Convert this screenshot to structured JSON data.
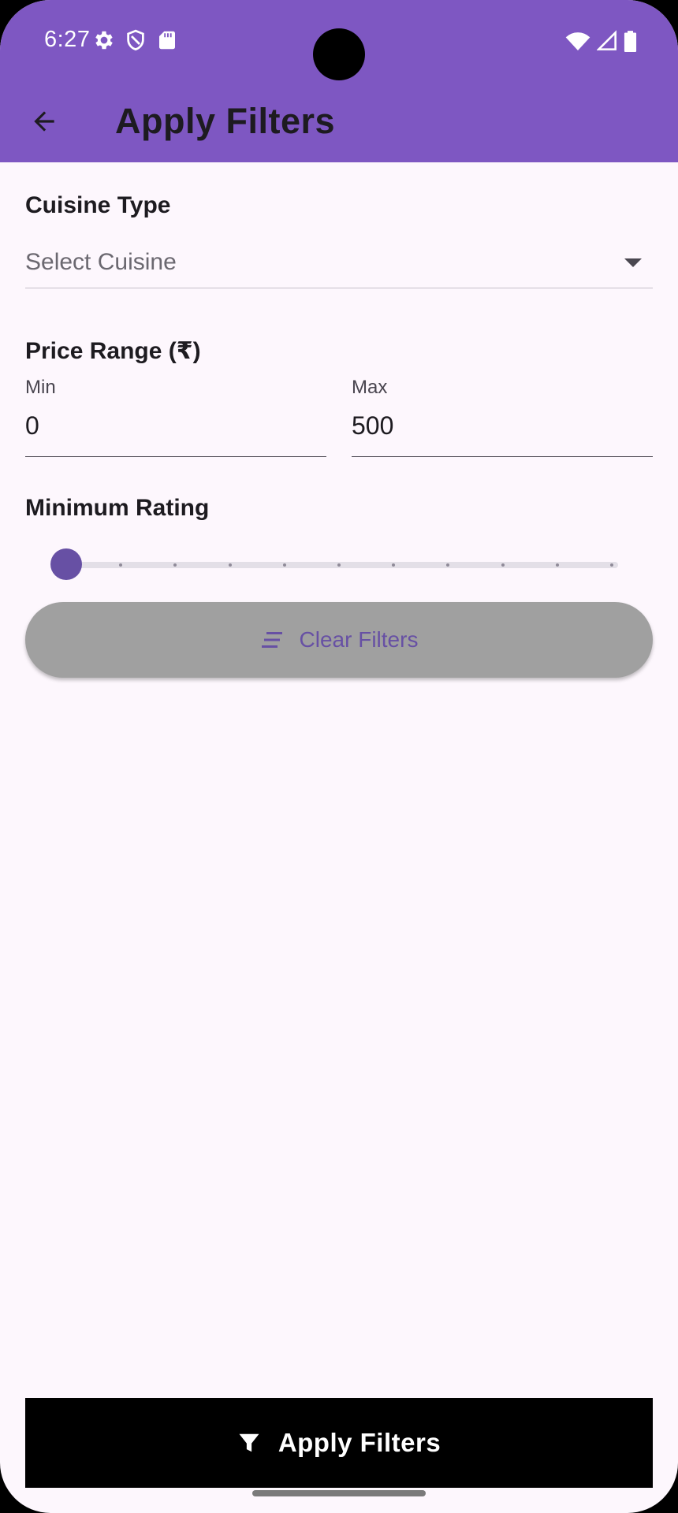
{
  "status_bar": {
    "time": "6:27",
    "left_icons": [
      "gear-icon",
      "shield-icon",
      "sd-card-icon"
    ],
    "right_icons": [
      "wifi-icon",
      "signal-icon",
      "battery-icon"
    ]
  },
  "app_bar": {
    "back_icon": "arrow-left-icon",
    "title": "Apply Filters",
    "background_color": "#7e57c2"
  },
  "cuisine": {
    "label": "Cuisine Type",
    "placeholder": "Select Cuisine"
  },
  "price": {
    "label": "Price Range (₹)",
    "min": {
      "label": "Min",
      "value": "0"
    },
    "max": {
      "label": "Max",
      "value": "500"
    }
  },
  "rating": {
    "label": "Minimum Rating",
    "value": 0,
    "min": 0,
    "max": 5,
    "divisions": 10
  },
  "clear_button": {
    "icon": "filter-list-icon",
    "label": "Clear Filters"
  },
  "apply_button": {
    "icon": "funnel-icon",
    "label": "Apply Filters"
  },
  "colors": {
    "primary": "#6750a4",
    "background": "#fdf7fd",
    "clear_button_bg": "#a0a0a0",
    "apply_button_bg": "#000000"
  }
}
